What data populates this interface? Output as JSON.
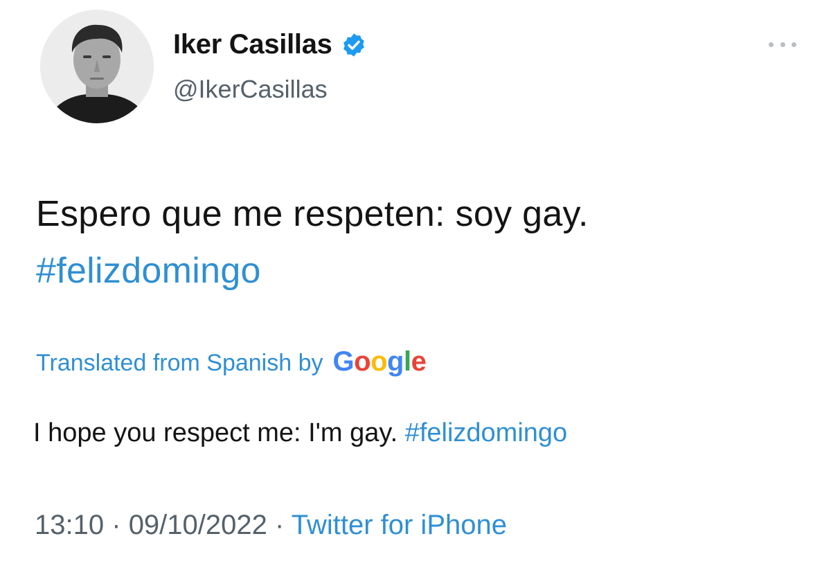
{
  "author": {
    "display_name": "Iker Casillas",
    "handle": "@IkerCasillas",
    "verified": true
  },
  "tweet": {
    "text_main": "Espero que me respeten: soy gay.",
    "hashtag": "#felizdomingo"
  },
  "translation": {
    "label": "Translated from Spanish by",
    "provider_letters": [
      "G",
      "o",
      "o",
      "g",
      "l",
      "e"
    ],
    "text": "I hope you respect me: I'm gay.",
    "hashtag": "#felizdomingo"
  },
  "meta": {
    "time": "13:10",
    "separator": "·",
    "date": "09/10/2022",
    "source": "Twitter for iPhone"
  },
  "colors": {
    "link_blue": "#2f8fd3",
    "verified_blue": "#1d9bf0",
    "secondary_text": "#55606a"
  },
  "icons": {
    "verified": "verified-badge-icon",
    "more": "more-options-icon"
  }
}
